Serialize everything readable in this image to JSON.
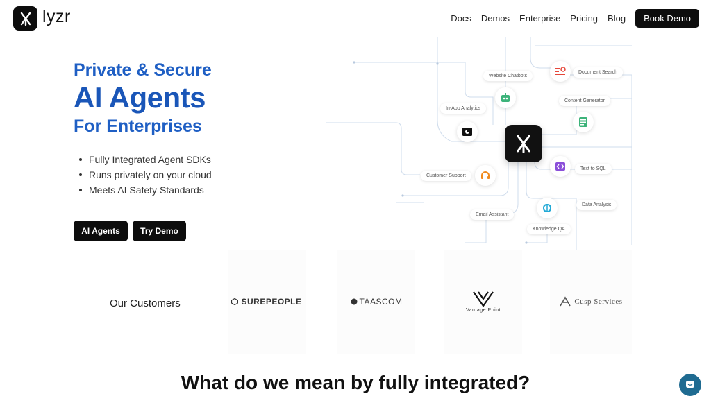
{
  "header": {
    "logo_text": "lyzr",
    "nav": [
      "Docs",
      "Demos",
      "Enterprise",
      "Pricing",
      "Blog"
    ],
    "cta_label": "Book Demo"
  },
  "hero": {
    "line1": "Private & Secure",
    "line2": "AI Agents",
    "line3": "For Enterprises",
    "bullets": [
      "Fully Integrated Agent SDKs",
      "Runs privately on your cloud",
      "Meets AI Safety Standards"
    ],
    "primary_cta": "AI Agents",
    "secondary_cta": "Try Demo"
  },
  "diagram": {
    "labels": {
      "website_chatbots": "Website Chatbots",
      "document_search": "Document Search",
      "inapp_analytics": "In-App Analytics",
      "content_generator": "Content Generator",
      "customer_support": "Customer Support",
      "text_to_sql": "Text to SQL",
      "data_analysis": "Data Analysis",
      "email_assistant": "Email Assistant",
      "knowledge_qa": "Knowledge QA"
    }
  },
  "customers": {
    "label": "Our Customers",
    "brands": [
      "SUREPEOPLE",
      "TAASCOM",
      "Vantage Point",
      "Cusp Services"
    ]
  },
  "bottom": {
    "title": "What do we mean by fully integrated?"
  },
  "colors": {
    "brand_blue": "#1a56b8",
    "dark": "#0d0d0d",
    "chat_button": "#1f6b91"
  }
}
